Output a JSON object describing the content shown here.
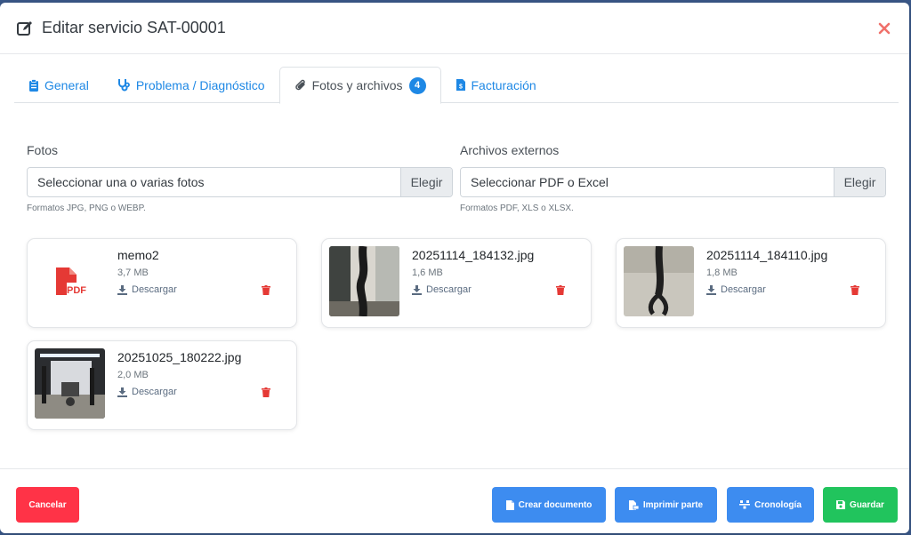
{
  "modal": {
    "title": "Editar servicio SAT-00001"
  },
  "tabs": [
    {
      "label": "General",
      "icon": "clipboard-icon",
      "active": false
    },
    {
      "label": "Problema / Diagnóstico",
      "icon": "stethoscope-icon",
      "active": false
    },
    {
      "label": "Fotos y archivos",
      "icon": "paperclip-icon",
      "active": true,
      "badge": "4"
    },
    {
      "label": "Facturación",
      "icon": "invoice-icon",
      "active": false
    }
  ],
  "uploads": {
    "photos": {
      "label": "Fotos",
      "placeholder": "Seleccionar una o varias fotos",
      "button": "Elegir",
      "help": "Formatos JPG, PNG o WEBP."
    },
    "files": {
      "label": "Archivos externos",
      "placeholder": "Seleccionar PDF o Excel",
      "button": "Elegir",
      "help": "Formatos PDF, XLS o XLSX."
    }
  },
  "attachments": [
    {
      "name": "memo2",
      "size": "3,7 MB",
      "download": "Descargar",
      "type": "pdf"
    },
    {
      "name": "20251114_184132.jpg",
      "size": "1,6 MB",
      "download": "Descargar",
      "type": "photo"
    },
    {
      "name": "20251114_184110.jpg",
      "size": "1,8 MB",
      "download": "Descargar",
      "type": "photo"
    },
    {
      "name": "20251025_180222.jpg",
      "size": "2,0 MB",
      "download": "Descargar",
      "type": "photo"
    }
  ],
  "pdf_label": "PDF",
  "footer": {
    "cancel": "Cancelar",
    "create_doc": "Crear documento",
    "print": "Imprimir parte",
    "timeline": "Cronología",
    "save": "Guardar"
  },
  "colors": {
    "primary": "#3d8cf0",
    "danger": "#ff3347",
    "success": "#21c45d",
    "link": "#1e88e5"
  }
}
